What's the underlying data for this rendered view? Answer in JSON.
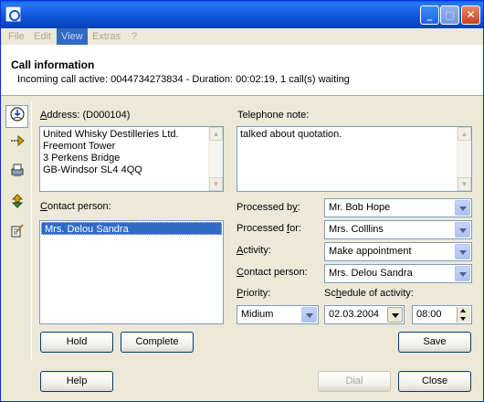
{
  "menu": {
    "items": [
      "File",
      "Edit",
      "View",
      "Extras",
      "?"
    ],
    "active": "View"
  },
  "info": {
    "title": "Call information",
    "status": "Incoming call active: 0044734273834 - Duration: 00:02:19, 1 call(s) waiting"
  },
  "sidebar": {
    "icons": [
      "call-icon",
      "forward-arrow-icon",
      "printer-icon",
      "transfer-icon",
      "note-icon"
    ]
  },
  "address": {
    "label_pre": "A",
    "label_post": "ddress: (D000104)",
    "lines": [
      "United Whisky Destilleries Ltd.",
      "Freemont Tower",
      "3 Perkens Bridge",
      "GB-Windsor SL4 4QQ"
    ]
  },
  "telephone_note": {
    "label": "Telephone note:",
    "value": "talked about quotation."
  },
  "contact_list": {
    "label_pre": "C",
    "label_post": "ontact person:",
    "selected": "Mrs. Delou Sandra"
  },
  "fields": {
    "processed_by": {
      "label_pre": "Processed b",
      "label_u": "y",
      "label_post": ":",
      "value": "Mr. Bob Hope"
    },
    "processed_for": {
      "label_pre": "Processed ",
      "label_u": "f",
      "label_post": "or:",
      "value": "Mrs. Colllins"
    },
    "activity": {
      "label_pre": "",
      "label_u": "A",
      "label_post": "ctivity:",
      "value": "Make appointment"
    },
    "contact_person": {
      "label_pre": "",
      "label_u": "C",
      "label_post": "ontact person:",
      "value": "Mrs. Delou Sandra"
    },
    "priority": {
      "label_pre": "",
      "label_u": "P",
      "label_post": "riority:",
      "value": "Midium"
    },
    "schedule": {
      "label_pre": "Sc",
      "label_u": "h",
      "label_post": "edule of activity:",
      "date": "02.03.2004",
      "time": "08:00"
    }
  },
  "buttons": {
    "hold": "Hold",
    "complete": "Complete",
    "save": "Save",
    "help": "Help",
    "dial": "Dial",
    "close": "Close"
  },
  "colors": {
    "titlebar": "#0b54d6",
    "selection": "#316ac5",
    "face": "#ece9d8"
  }
}
